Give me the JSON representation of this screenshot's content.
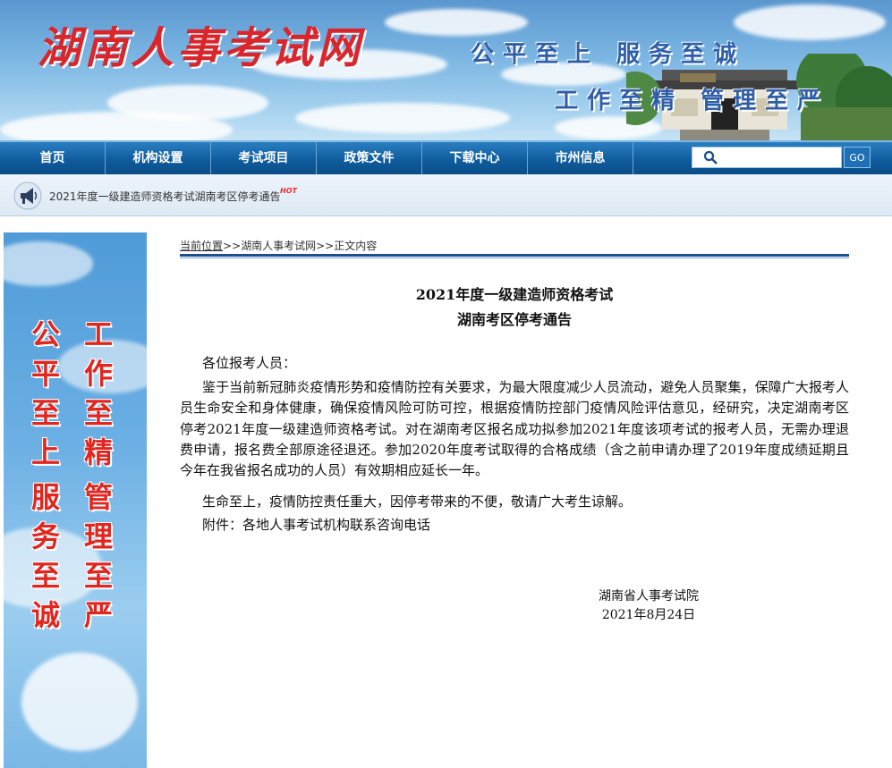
{
  "site": {
    "title": "湖南人事考试网",
    "slogan_line1": "公平至上 服务至诚",
    "slogan_line2": "工作至精 管理至严"
  },
  "nav": {
    "items": [
      "首页",
      "机构设置",
      "考试项目",
      "政策文件",
      "下载中心",
      "市州信息"
    ],
    "search_placeholder": "",
    "go_label": "GO"
  },
  "notice": {
    "text": "2021年度一级建造师资格考试湖南考区停考通告",
    "badge": "HOT"
  },
  "sidebar": {
    "columns": [
      [
        "公",
        "平",
        "至",
        "上"
      ],
      [
        "工",
        "作",
        "至",
        "精"
      ],
      [
        "服",
        "务",
        "至",
        "诚"
      ],
      [
        "管",
        "理",
        "至",
        "严"
      ]
    ]
  },
  "breadcrumb": {
    "label": "当前位置",
    "path": ">>湖南人事考试网>>正文内容"
  },
  "article": {
    "title_line1": "2021年度一级建造师资格考试",
    "title_line2": "湖南考区停考通告",
    "salutation": "各位报考人员：",
    "para1": "鉴于当前新冠肺炎疫情形势和疫情防控有关要求，为最大限度减少人员流动，避免人员聚集，保障广大报考人员生命安全和身体健康，确保疫情风险可防可控，根据疫情防控部门疫情风险评估意见，经研究，决定湖南考区停考2021年度一级建造师资格考试。对在湖南考区报名成功拟参加2021年度该项考试的报考人员，无需办理退费申请，报名费全部原途径退还。参加2020年度考试取得的合格成绩（含之前申请办理了2019年度成绩延期且今年在我省报名成功的人员）有效期相应延长一年。",
    "para2": "生命至上，疫情防控责任重大，因停考带来的不便，敬请广大考生谅解。",
    "attachment": "附件：各地人事考试机构联系咨询电话",
    "org": "湖南省人事考试院",
    "date": "2021年8月24日"
  },
  "colors": {
    "nav_bg": "#0f5c9e",
    "title_red": "#d9262c",
    "slogan_blue": "#2f5ea8",
    "rule_blue": "#1d4f8c"
  }
}
